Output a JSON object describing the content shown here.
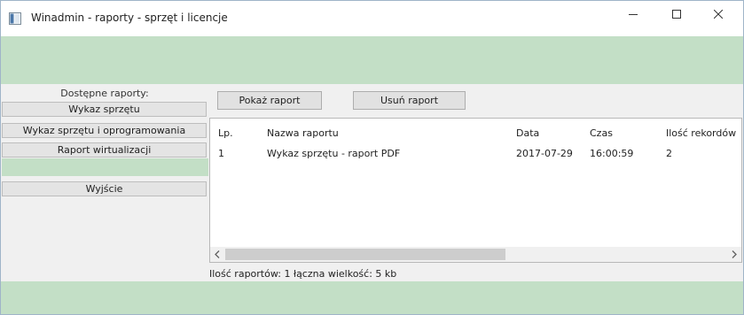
{
  "window": {
    "title": "Winadmin - raporty - sprzęt i licencje"
  },
  "left": {
    "caption": "Dostępne raporty:",
    "buttons": [
      "Wykaz sprzętu",
      "Wykaz sprzętu i oprogramowania",
      "Raport wirtualizacji"
    ],
    "exit": "Wyjście"
  },
  "toolbar": {
    "show": "Pokaż raport",
    "delete": "Usuń raport"
  },
  "table": {
    "columns": [
      "Lp.",
      "Nazwa raportu",
      "Data",
      "Czas",
      "Ilość rekordów"
    ],
    "rows": [
      [
        "1",
        "Wykaz sprzętu - raport PDF",
        "2017-07-29",
        "16:00:59",
        "2"
      ]
    ]
  },
  "status": "Ilość raportów: 1 łączna wielkość: 5 kb",
  "icons": {
    "app": "window-app-icon",
    "minimize": "minimize-icon",
    "maximize": "maximize-icon",
    "close": "close-icon",
    "scroll_left": "arrow-left-icon",
    "scroll_right": "arrow-right-icon"
  },
  "colors": {
    "accent_green": "#c3dfc6"
  }
}
